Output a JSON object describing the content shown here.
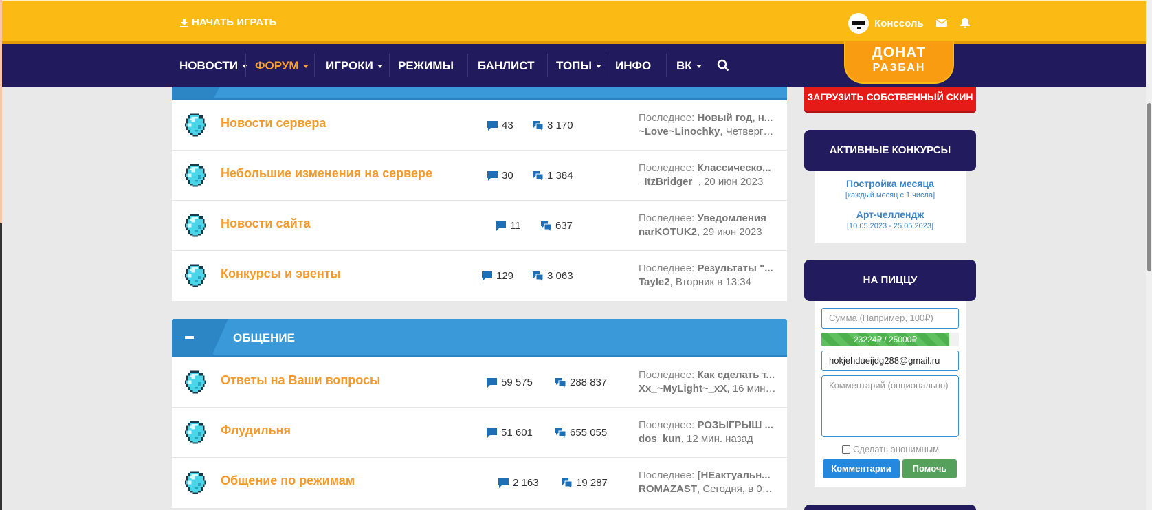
{
  "topbar": {
    "play_label": "НАЧАТЬ ИГРАТЬ",
    "username": "Конссоль"
  },
  "nav": {
    "items": [
      {
        "label": "НОВОСТИ",
        "has_caret": true
      },
      {
        "label": "ФОРУМ",
        "has_caret": true,
        "active": true
      },
      {
        "label": "ИГРОКИ",
        "has_caret": true
      },
      {
        "label": "РЕЖИМЫ",
        "has_caret": false
      },
      {
        "label": "БАНЛИСТ",
        "has_caret": false
      },
      {
        "label": "ТОПЫ",
        "has_caret": true
      },
      {
        "label": "ИНФО",
        "has_caret": false
      },
      {
        "label": "ВК",
        "has_caret": true
      }
    ],
    "donate_line1": "ДОНАТ",
    "donate_line2": "РАЗБАН"
  },
  "forum": {
    "last_label": "Последнее:",
    "section1": {
      "rows": [
        {
          "title": "Новости сервера",
          "threads": "43",
          "posts": "3 170",
          "last_title": "Новый год, н...",
          "last_user": "~Love~Linochky",
          "last_time": ", Четверг в..."
        },
        {
          "title": "Небольшие изменения на сервере",
          "threads": "30",
          "posts": "1 384",
          "last_title": "Классическо...",
          "last_user": "_ItzBridger_",
          "last_time": ", 20 июн 2023"
        },
        {
          "title": "Новости сайта",
          "threads": "11",
          "posts": "637",
          "last_title": "Уведомления",
          "last_user": "narKOTUK2",
          "last_time": ", 29 июн 2023"
        },
        {
          "title": "Конкурсы и эвенты",
          "threads": "129",
          "posts": "3 063",
          "last_title": "Результаты \"...",
          "last_user": "Tayle2",
          "last_time": ", Вторник в 13:34"
        }
      ]
    },
    "section2": {
      "title": "ОБЩЕНИЕ",
      "rows": [
        {
          "title": "Ответы на Ваши вопросы",
          "threads": "59 575",
          "posts": "288 837",
          "last_title": "Как сделать т...",
          "last_user": "Xx_~MyLight~_xX",
          "last_time": ", 16 мин. ..."
        },
        {
          "title": "Флудильня",
          "threads": "51 601",
          "posts": "655 055",
          "last_title": "РОЗЫГРЫШ ...",
          "last_user": "dos_kun",
          "last_time": ", 12 мин. назад"
        },
        {
          "title": "Общение по режимам",
          "threads": "2 163",
          "posts": "19 287",
          "last_title": "[НЕактуальн...",
          "last_user": "ROMAZAST",
          "last_time": ", Сегодня, в 09..."
        }
      ]
    }
  },
  "sidebar": {
    "skin_button": "ЗАГРУЗИТЬ СОБСТВЕННЫЙ СКИН",
    "contests_title": "АКТИВНЫЕ КОНКУРСЫ",
    "contests": [
      {
        "name": "Постройка месяца",
        "dates": "[каждый месяц с 1 числа]"
      },
      {
        "name": "Арт-челлендж",
        "dates": "[10.05.2023 - 25.05.2023]"
      }
    ],
    "pizza_title": "НА ПИЦЦУ",
    "amount_placeholder": "Сумма (Например, 100₽)",
    "progress_text": "23224₽ / 25000₽",
    "progress_fraction": 0.929,
    "email_value": "hokjehdueijdg288@gmail.ru",
    "comment_placeholder": "Комментарий (опционально)",
    "anon_label": "Сделать анонимным",
    "comments_button": "Комментарии",
    "help_button": "Помочь"
  }
}
